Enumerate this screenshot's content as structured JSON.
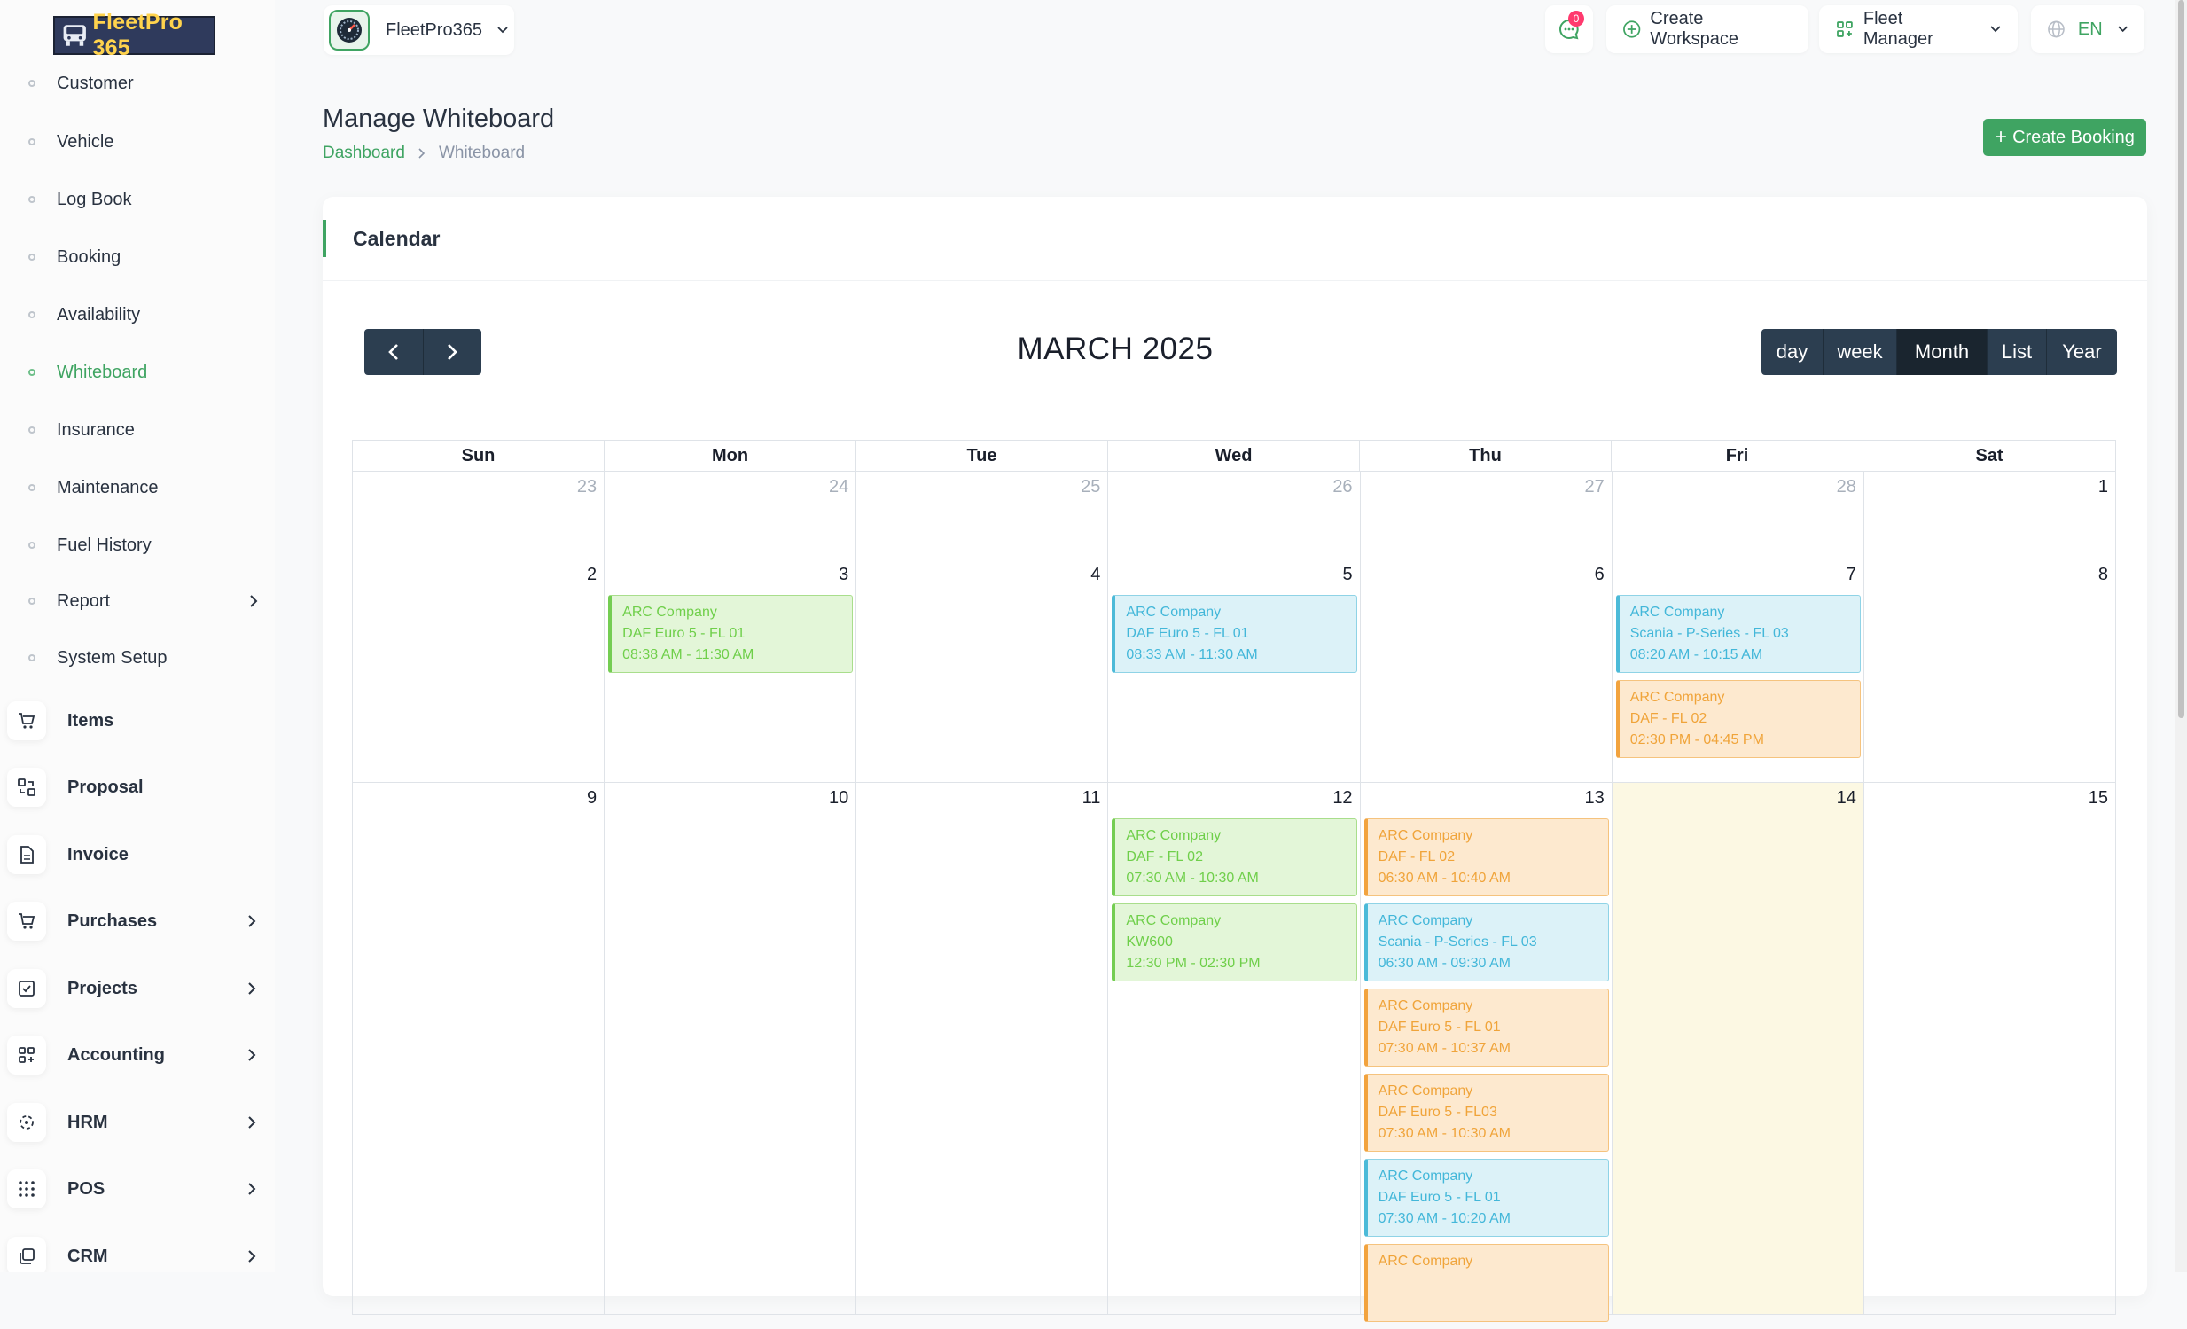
{
  "brand": {
    "logo_text": "FleetPro 365",
    "accent": "#3fa462"
  },
  "sidebar": {
    "sub_items": [
      {
        "label": "Customer",
        "active": false
      },
      {
        "label": "Vehicle",
        "active": false
      },
      {
        "label": "Log Book",
        "active": false
      },
      {
        "label": "Booking",
        "active": false
      },
      {
        "label": "Availability",
        "active": false
      },
      {
        "label": "Whiteboard",
        "active": true
      },
      {
        "label": "Insurance",
        "active": false
      },
      {
        "label": "Maintenance",
        "active": false
      },
      {
        "label": "Fuel History",
        "active": false
      },
      {
        "label": "Report",
        "active": false,
        "has_children": true
      },
      {
        "label": "System Setup",
        "active": false
      }
    ],
    "main_items": [
      {
        "label": "Items",
        "icon": "cart-icon",
        "has_children": false
      },
      {
        "label": "Proposal",
        "icon": "proposal-icon",
        "has_children": false
      },
      {
        "label": "Invoice",
        "icon": "file-icon",
        "has_children": false
      },
      {
        "label": "Purchases",
        "icon": "cart-icon",
        "has_children": true
      },
      {
        "label": "Projects",
        "icon": "check-square-icon",
        "has_children": true
      },
      {
        "label": "Accounting",
        "icon": "grid-icon",
        "has_children": true
      },
      {
        "label": "HRM",
        "icon": "hrm-icon",
        "has_children": true
      },
      {
        "label": "POS",
        "icon": "dots-grid-icon",
        "has_children": true
      },
      {
        "label": "CRM",
        "icon": "layers-icon",
        "has_children": true
      }
    ]
  },
  "topbar": {
    "workspace": "FleetPro365",
    "message_count": "0",
    "create_workspace": "Create Workspace",
    "role": "Fleet Manager",
    "language": "EN"
  },
  "page": {
    "title": "Manage Whiteboard",
    "breadcrumb": {
      "root": "Dashboard",
      "current": "Whiteboard"
    },
    "create_booking": "Create Booking"
  },
  "calendar": {
    "card_title": "Calendar",
    "title": "MARCH 2025",
    "views": [
      {
        "label": "day",
        "active": false
      },
      {
        "label": "week",
        "active": false
      },
      {
        "label": "Month",
        "active": true
      },
      {
        "label": "List",
        "active": false
      },
      {
        "label": "Year",
        "active": false
      }
    ],
    "weekdays": [
      "Sun",
      "Mon",
      "Tue",
      "Wed",
      "Thu",
      "Fri",
      "Sat"
    ],
    "weeks": [
      {
        "days": [
          {
            "num": "23",
            "other": true,
            "events": []
          },
          {
            "num": "24",
            "other": true,
            "events": []
          },
          {
            "num": "25",
            "other": true,
            "events": []
          },
          {
            "num": "26",
            "other": true,
            "events": []
          },
          {
            "num": "27",
            "other": true,
            "events": []
          },
          {
            "num": "28",
            "other": true,
            "events": []
          },
          {
            "num": "1",
            "other": false,
            "events": []
          }
        ]
      },
      {
        "days": [
          {
            "num": "2",
            "events": []
          },
          {
            "num": "3",
            "events": [
              {
                "company": "ARC Company",
                "vehicle": "DAF Euro 5 - FL 01",
                "time": "08:38 AM - 11:30 AM",
                "color": "green"
              }
            ]
          },
          {
            "num": "4",
            "events": []
          },
          {
            "num": "5",
            "events": [
              {
                "company": "ARC Company",
                "vehicle": "DAF Euro 5 - FL 01",
                "time": "08:33 AM - 11:30 AM",
                "color": "blue"
              }
            ]
          },
          {
            "num": "6",
            "events": []
          },
          {
            "num": "7",
            "events": [
              {
                "company": "ARC Company",
                "vehicle": "Scania - P-Series - FL 03",
                "time": "08:20 AM - 10:15 AM",
                "color": "blue"
              },
              {
                "company": "ARC Company",
                "vehicle": "DAF - FL 02",
                "time": "02:30 PM - 04:45 PM",
                "color": "orange"
              }
            ]
          },
          {
            "num": "8",
            "events": []
          }
        ]
      },
      {
        "days": [
          {
            "num": "9",
            "events": []
          },
          {
            "num": "10",
            "events": []
          },
          {
            "num": "11",
            "events": []
          },
          {
            "num": "12",
            "events": [
              {
                "company": "ARC Company",
                "vehicle": "DAF - FL 02",
                "time": "07:30 AM - 10:30 AM",
                "color": "green"
              },
              {
                "company": "ARC Company",
                "vehicle": "KW600",
                "time": "12:30 PM - 02:30 PM",
                "color": "green"
              }
            ]
          },
          {
            "num": "13",
            "events": [
              {
                "company": "ARC Company",
                "vehicle": "DAF - FL 02",
                "time": "06:30 AM - 10:40 AM",
                "color": "orange"
              },
              {
                "company": "ARC Company",
                "vehicle": "Scania - P-Series - FL 03",
                "time": "06:30 AM - 09:30 AM",
                "color": "blue"
              },
              {
                "company": "ARC Company",
                "vehicle": "DAF Euro 5 - FL 01",
                "time": "07:30 AM - 10:37 AM",
                "color": "orange"
              },
              {
                "company": "ARC Company",
                "vehicle": "DAF Euro 5 - FL03",
                "time": "07:30 AM - 10:30 AM",
                "color": "orange"
              },
              {
                "company": "ARC Company",
                "vehicle": "DAF Euro 5 - FL 01",
                "time": "07:30 AM - 10:20 AM",
                "color": "blue"
              },
              {
                "company": "ARC Company",
                "vehicle": "",
                "time": "",
                "color": "orange"
              }
            ]
          },
          {
            "num": "14",
            "today": true,
            "events": []
          },
          {
            "num": "15",
            "events": []
          }
        ]
      }
    ]
  }
}
